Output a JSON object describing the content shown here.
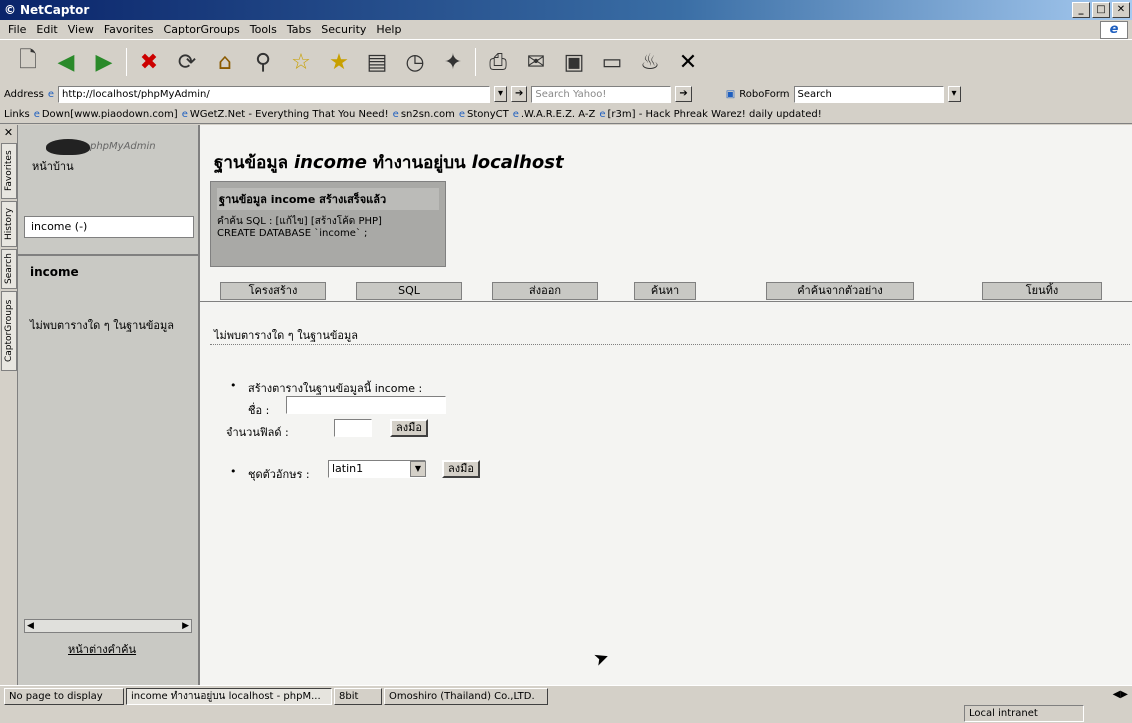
{
  "window": {
    "title": "NetCaptor"
  },
  "menu": [
    "File",
    "Edit",
    "View",
    "Favorites",
    "CaptorGroups",
    "Tools",
    "Tabs",
    "Security",
    "Help"
  ],
  "address": {
    "label": "Address",
    "url": "http://localhost/phpMyAdmin/",
    "search_placeholder": "Search Yahoo!",
    "roboform_label": "RoboForm",
    "roboform_search": "Search"
  },
  "links": {
    "label": "Links",
    "items": [
      "Down[www.piaodown.com]",
      "WGetZ.Net - Everything That You Need!",
      "sn2sn.com",
      "StonyCT",
      ".W.A.R.E.Z. A-Z",
      "[r3m] - Hack Phreak Warez! daily updated!"
    ]
  },
  "explorer_tabs": [
    "Favorites",
    "History",
    "Search",
    "CaptorGroups"
  ],
  "left": {
    "logo_text": "phpMyAdmin",
    "home_label": "หน้าบ้าน",
    "db_select": "income (-)",
    "db_name": "income",
    "no_tables": "ไม่พบตารางใด ๆ ในฐานข้อมูล",
    "query_window_link": "หน้าต่างคำค้น"
  },
  "main": {
    "title_prefix": "ฐานข้อมูล",
    "title_db": "income",
    "title_middle": "ทำงานอยู่บน",
    "title_host": "localhost",
    "notice_title": "ฐานข้อมูล income สร้างเสร็จแล้ว",
    "notice_sql_label": "คำค้น SQL : [แก้ไข] [สร้างโค้ด PHP]",
    "notice_sql": "CREATE DATABASE `income` ;",
    "tabs": [
      "โครงสร้าง",
      "SQL",
      "ส่งออก",
      "ค้นหา",
      "คำค้นจากตัวอย่าง",
      "โยนทิ้ง"
    ],
    "no_tables": "ไม่พบตารางใด ๆ ในฐานข้อมูล",
    "create_table_label": "สร้างตารางในฐานข้อมูลนี้ income :",
    "name_label": "ชื่อ :",
    "fields_label": "จำนวนฟิลด์ :",
    "go_label": "ลงมือ",
    "charset_label": "ชุดตัวอักษร :",
    "charset_value": "latin1"
  },
  "taskbar": {
    "items": [
      "No page to display",
      "income ทำงานอยู่บน localhost - phpM...",
      "8bit",
      "Omoshiro (Thailand) Co.,LTD."
    ],
    "zone": "Local intranet"
  }
}
